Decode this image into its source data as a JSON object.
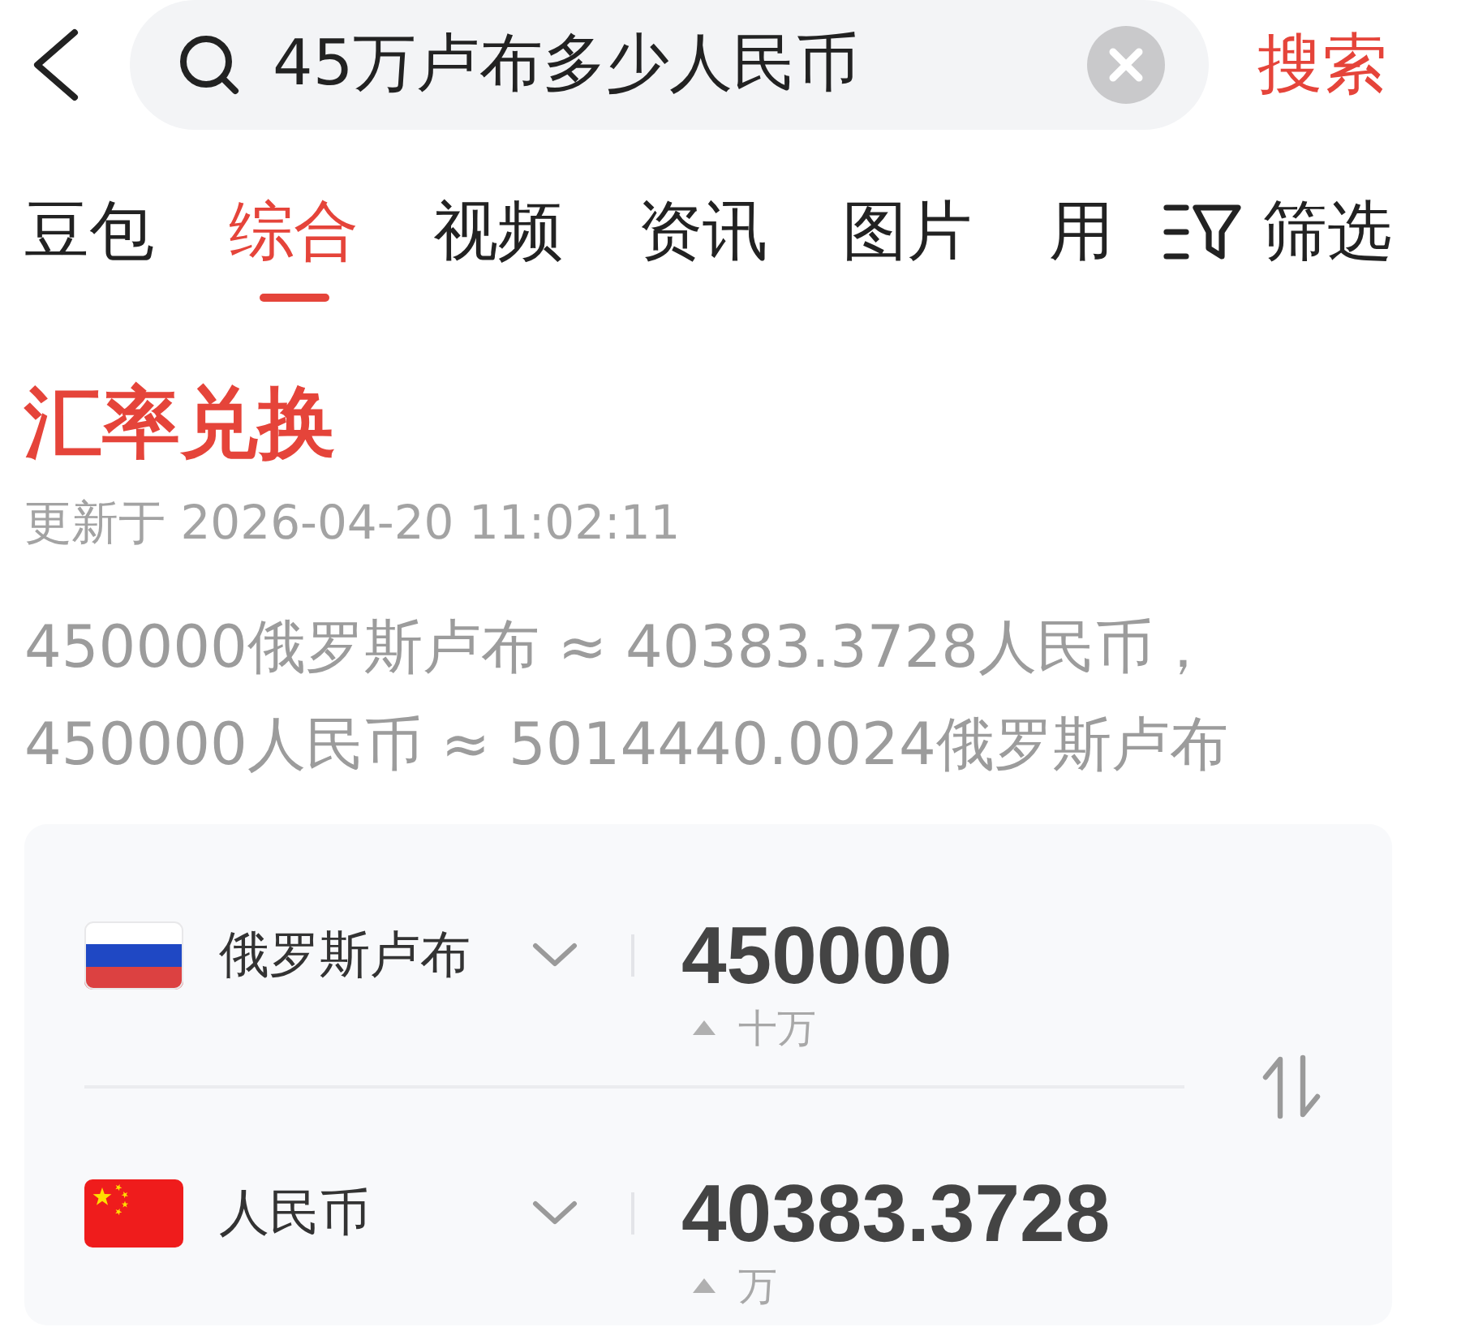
{
  "search": {
    "query": "45万卢布多少人民币",
    "submit": "搜索"
  },
  "tabs": [
    {
      "label": "豆包",
      "selected": false
    },
    {
      "label": "综合",
      "selected": true
    },
    {
      "label": "视频",
      "selected": false
    },
    {
      "label": "资讯",
      "selected": false
    },
    {
      "label": "图片",
      "selected": false
    },
    {
      "label": "用",
      "selected": false
    }
  ],
  "filter": {
    "label": "筛选"
  },
  "exchange": {
    "title": "汇率兑换",
    "updated": "更新于 2026-04-20 11:02:11",
    "rates": [
      "450000俄罗斯卢布 ≈ 40383.3728人民币，",
      "450000人民币 ≈ 5014440.0024俄罗斯卢布"
    ],
    "currencies": [
      {
        "kind": "russia",
        "name": "俄罗斯卢布",
        "amount": "450000",
        "magnitude": "十万"
      },
      {
        "kind": "china",
        "name": "人民币",
        "amount": "40383.3728",
        "magnitude": "万"
      }
    ]
  }
}
